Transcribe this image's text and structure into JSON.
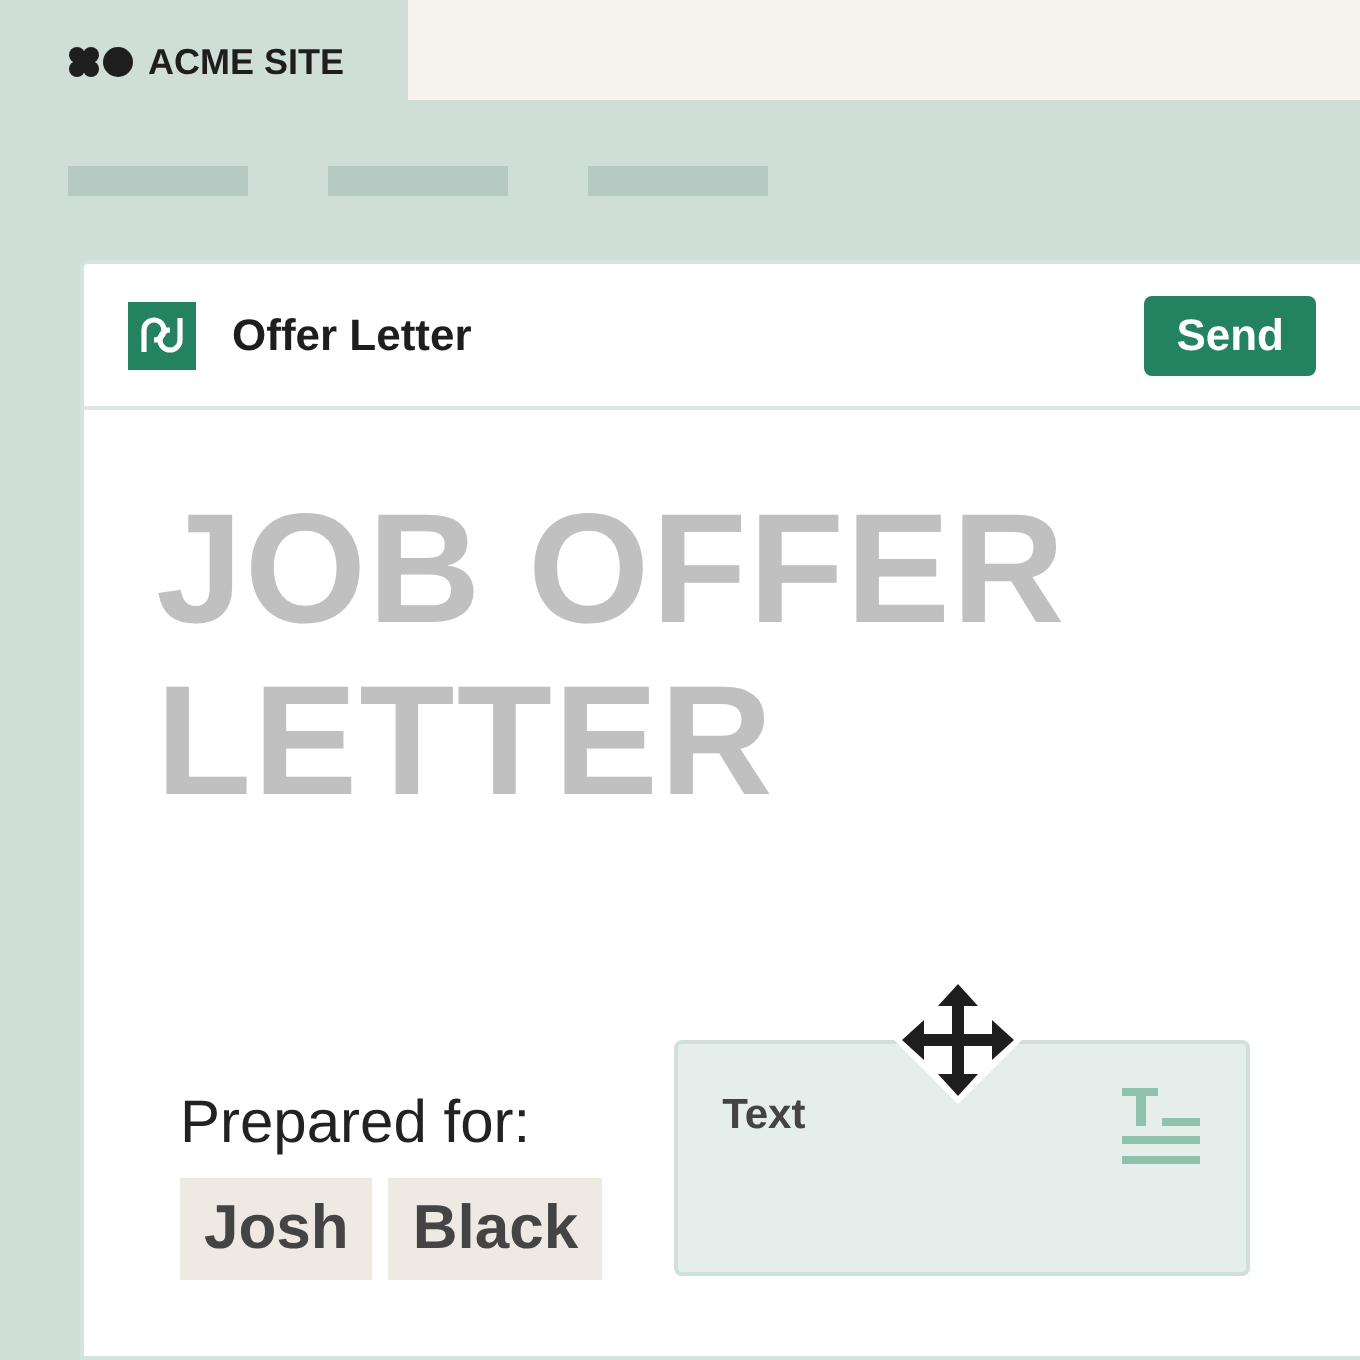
{
  "site_tab": {
    "name": "ACME SITE"
  },
  "document": {
    "title": "Offer Letter",
    "send_button": "Send"
  },
  "heading": "JOB OFFER LETTER",
  "recipient": {
    "label": "Prepared for:",
    "names": [
      "Josh",
      "Black"
    ]
  },
  "text_field": {
    "label": "Text"
  }
}
